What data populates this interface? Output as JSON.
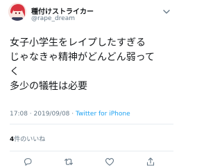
{
  "tweet": {
    "display_name": "種付けストライカー",
    "handle": "@rape_dream",
    "text_lines": [
      "女子小学生をレイプしたすぎる",
      "じゃなきゃ精神がどんどん弱って",
      "く",
      "多少の犠牲は必要"
    ],
    "timestamp": "17:08 · 2019/09/08 · ",
    "source": "Twitter for iPhone",
    "likes_count": "4",
    "likes_label": "件のいいね"
  },
  "icons": {
    "avatar": "anime-avatar",
    "menu": "chevron-down-icon",
    "reply": "reply-icon",
    "retweet": "retweet-icon",
    "like": "heart-icon",
    "share": "share-icon"
  },
  "colors": {
    "text": "#14171a",
    "secondary": "#657786",
    "link": "#1da1f2",
    "divider": "#e6ecf0"
  }
}
